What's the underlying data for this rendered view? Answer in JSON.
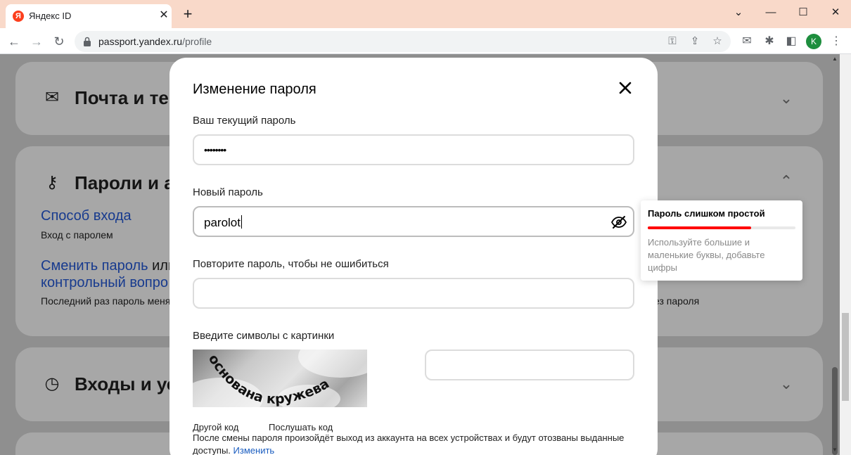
{
  "browser": {
    "tab_title": "Яндекс ID",
    "tab_favicon_letter": "Я",
    "url_host": "passport.yandex.ru",
    "url_path": "/profile",
    "profile_initial": "K"
  },
  "page": {
    "mail_card": {
      "title": "Почта и те"
    },
    "passwords_card": {
      "title": "Пароли и а",
      "login_method_link": "Способ входа",
      "login_method_value": "Вход с паролем",
      "change_link": "Сменить пароль",
      "change_link_rest": " или",
      "control_question_link": "контрольный вопро",
      "last_changed": "Последний раз пароль меня",
      "right_text": "ез пароля"
    },
    "logins_card": {
      "title": "Входы и ус"
    }
  },
  "modal": {
    "title": "Изменение пароля",
    "current_password_label": "Ваш текущий пароль",
    "current_password_value": "••••••••",
    "new_password_label": "Новый пароль",
    "new_password_value": "parolot",
    "repeat_password_label": "Повторите пароль, чтобы не ошибиться",
    "repeat_password_value": "",
    "captcha_label": "Введите символы с картинки",
    "captcha_text": "основана кружева",
    "captcha_input_value": "",
    "other_code_link": "Другой код",
    "listen_code_link": "Послушать код",
    "notice_text": "После смены пароля произойдёт выход из аккаунта на всех устройствах и будут отозваны выданные доступы.",
    "notice_link": "Изменить"
  },
  "password_hint": {
    "title": "Пароль слишком простой",
    "strength": 0.7,
    "strength_color": "#ff0000",
    "text": "Используйте большие и маленькие буквы, добавьте цифры"
  }
}
